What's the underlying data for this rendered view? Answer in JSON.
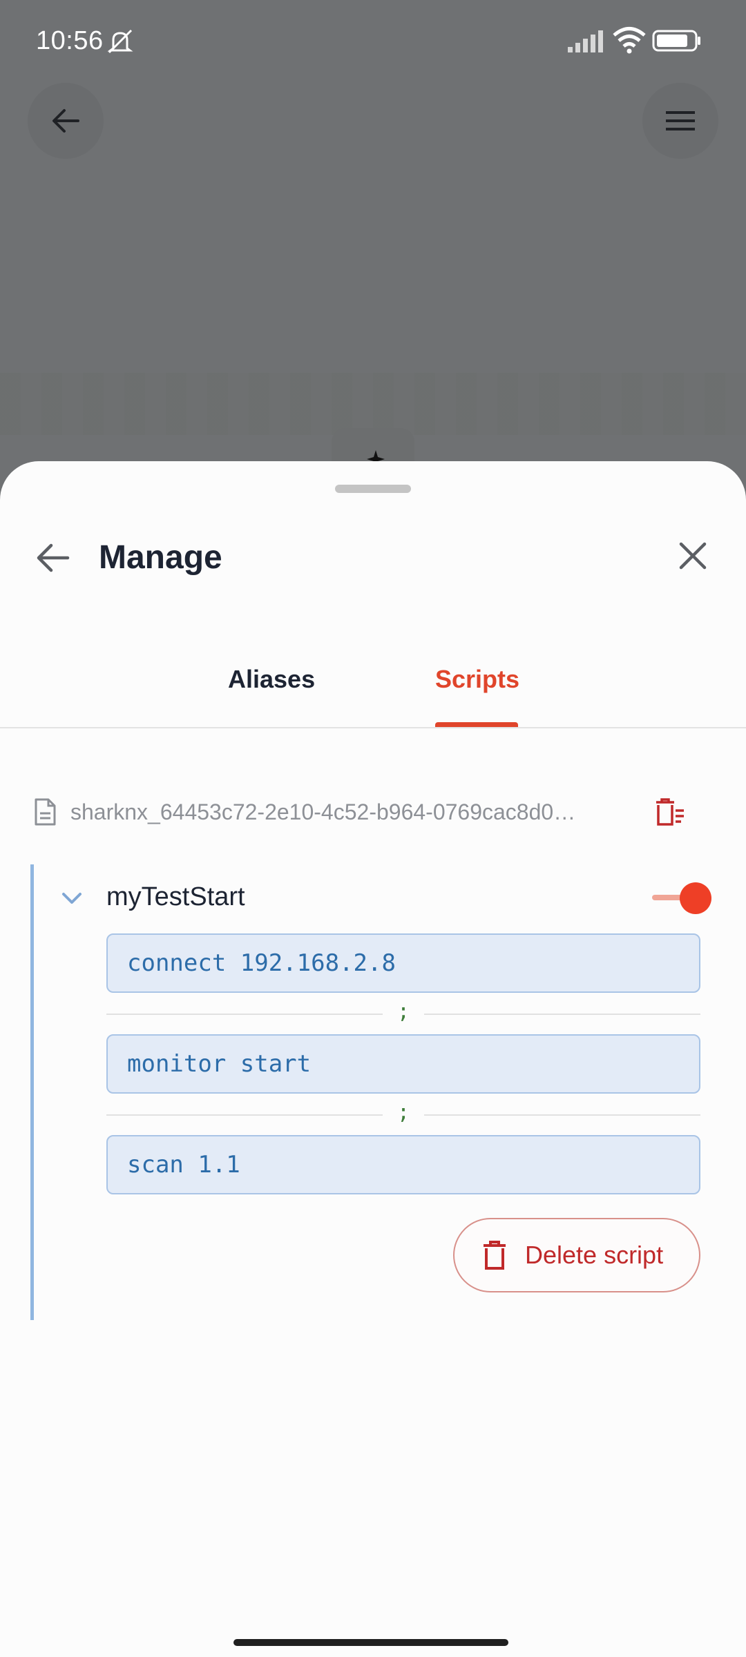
{
  "status_bar": {
    "time": "10:56"
  },
  "background": {
    "back_icon": "arrow-left-icon",
    "menu_icon": "hamburger-menu-icon"
  },
  "sheet": {
    "title": "Manage",
    "back_icon": "arrow-left-icon",
    "close_icon": "close-icon",
    "tabs": [
      {
        "label": "Aliases",
        "selected": false
      },
      {
        "label": "Scripts",
        "selected": true
      }
    ]
  },
  "scripts_panel": {
    "file_name": "sharknx_64453c72-2e10-4c52-b964-0769cac8d0…",
    "file_icon": "document-icon",
    "delete_all_icon": "delete-list-icon",
    "script": {
      "name": "myTestStart",
      "enabled": true,
      "expanded": true,
      "commands": [
        "connect 192.168.2.8",
        "monitor start",
        "scan 1.1"
      ],
      "separator": ";",
      "delete_label": "Delete script"
    }
  },
  "colors": {
    "accent": "#e0452b",
    "danger": "#c0292a",
    "command_text": "#2c6ca9",
    "separator": "#3e7d3a"
  }
}
